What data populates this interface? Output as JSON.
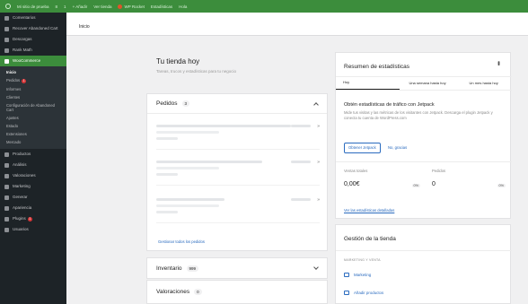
{
  "admin_bar": {
    "items": [
      "Mi sitio de prueba",
      "8",
      "1",
      "+ Añadir",
      "Ver tienda",
      "WP Rocket",
      "Estadísticas",
      "Hola"
    ]
  },
  "sidebar": {
    "top_items": [
      {
        "label": "Comentarios",
        "icon": "comment-icon"
      },
      {
        "label": "Recover Abandoned Cart",
        "icon": "cart-icon"
      },
      {
        "label": "Descargas",
        "icon": "download-icon"
      },
      {
        "label": "Rank Math",
        "icon": "chart-icon"
      }
    ],
    "current": {
      "label": "WooCommerce",
      "icon": "woo-icon"
    },
    "submenu": [
      {
        "label": "Inicio",
        "current": true
      },
      {
        "label": "Pedidos",
        "badge": "1"
      },
      {
        "label": "Informes"
      },
      {
        "label": "Clientes"
      },
      {
        "label": "Configuración de Abandoned Cart"
      },
      {
        "label": "Ajustes"
      },
      {
        "label": "Estado"
      },
      {
        "label": "Extensiones"
      },
      {
        "label": "Mercado"
      }
    ],
    "bottom_items": [
      {
        "label": "Productos",
        "icon": "box-icon"
      },
      {
        "label": "Análisis",
        "icon": "bar-chart-icon"
      },
      {
        "label": "Valoraciones",
        "icon": "star-icon"
      },
      {
        "label": "Marketing",
        "icon": "megaphone-icon"
      },
      {
        "label": "Generar",
        "icon": "gear-icon"
      },
      {
        "label": "Apariencia",
        "icon": "brush-icon"
      },
      {
        "label": "Plugins",
        "icon": "plugin-icon",
        "badge": "1"
      },
      {
        "label": "Usuarios",
        "icon": "users-icon"
      }
    ]
  },
  "header": {
    "breadcrumb": "Inicio"
  },
  "main": {
    "title": "Tu tienda hoy",
    "subtitle": "Tareas, trucos y estadísticas para tu negocio",
    "orders": {
      "title": "Pedidos",
      "count": "3",
      "link": "Gestionar todos los pedidos"
    },
    "inventory": {
      "title": "Inventario",
      "count": "999"
    },
    "reviews": {
      "title": "Valoraciones",
      "count": "0"
    }
  },
  "stats": {
    "title": "Resumen de estadísticas",
    "tabs": [
      "Hoy",
      "Una semana hasta hoy",
      "Un mes hasta hoy"
    ],
    "active_tab": 0,
    "jetpack_title": "Obtén estadísticas de tráfico con Jetpack",
    "jetpack_desc": "Mide tus visitas y las métricas de los visitantes con Jetpack. Descarga el plugin Jetpack y conecta tu cuenta de WordPress.com",
    "get_button": "Obtener Jetpack",
    "no_thanks": "No, gracias",
    "net_sales_label": "Ventas totales",
    "net_sales_value": "0,00€",
    "net_sales_delta": "0%",
    "orders_label": "Pedidos",
    "orders_value": "0",
    "orders_delta": "0%",
    "view_link": "Ver las estadísticas detalladas"
  },
  "store": {
    "title": "Gestión de la tienda",
    "section": "MARKETING Y VENTA",
    "links": [
      {
        "label": "Marketing",
        "icon": "megaphone-icon"
      },
      {
        "label": "Añadir productos",
        "icon": "add-product-icon"
      }
    ]
  },
  "colors": {
    "accent": "#3c8d3c",
    "sidebar_bg": "#1d2327",
    "link": "#2a6bbf",
    "badge": "#d63638"
  }
}
